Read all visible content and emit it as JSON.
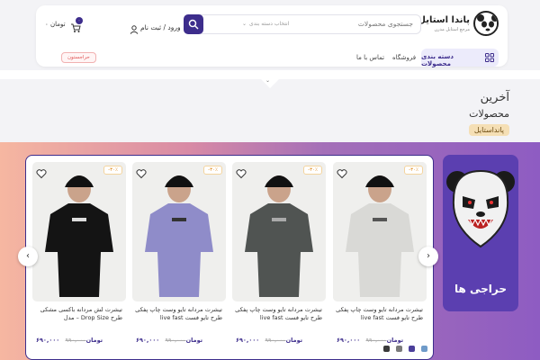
{
  "brand": {
    "name": "پاندا استایل",
    "tagline": "مرجع استایل مدرن"
  },
  "search": {
    "placeholder": "جستجوی محصولات",
    "category": "انتخاب دسته بندی"
  },
  "header": {
    "login": "ورود / ثبت نام",
    "cart_badge": "۰",
    "cart_amount": "۰ تومان"
  },
  "nav": {
    "categories": "دسته بندی محصولات",
    "shop": "فروشگاه",
    "contact": "تماس با ما",
    "special": "حراجستون"
  },
  "section": {
    "title_line1": "آخرین",
    "title_line2": "محصولات",
    "tag": "پانداستایل"
  },
  "promo": {
    "label": "حراجی ها"
  },
  "products": [
    {
      "title": "تیشرت مردانه تایو وست چاپ پفکی طرح تایو فست live fast",
      "old_price": "۹۹۰,۰۰۰",
      "price": "۶۹۰,۰۰۰ تومان",
      "discount": "-۳۰٪",
      "shirt_color": "#d9d9d6"
    },
    {
      "title": "تیشرت مردانه تایو وست چاپ پفکی طرح تایو فست live fast",
      "old_price": "۹۹۰,۰۰۰",
      "price": "۶۹۰,۰۰۰ تومان",
      "discount": "-۳۰٪",
      "shirt_color": "#505452"
    },
    {
      "title": "تیشرت مردانه تایو وست چاپ پفکی طرح تایو فست live fast",
      "old_price": "۹۹۰,۰۰۰",
      "price": "۶۹۰,۰۰۰ تومان",
      "discount": "-۳۰٪",
      "shirt_color": "#8f8cc9"
    },
    {
      "title": "تیشرت لش مردانه باکسی مشکی طرح Drop Size – مدل",
      "old_price": "۹۹۰,۰۰۰",
      "price": "۶۹۰,۰۰۰ تومان",
      "discount": "-۳۰٪",
      "shirt_color": "#141414"
    }
  ],
  "color_swatches": [
    "#6f9bc9",
    "#4b3f9a",
    "#7a7a7a",
    "#3a3a3a"
  ],
  "colors": {
    "accent": "#3d2d8c",
    "promo_bg": "#5b3fb0",
    "discount": "#e08a1b"
  }
}
